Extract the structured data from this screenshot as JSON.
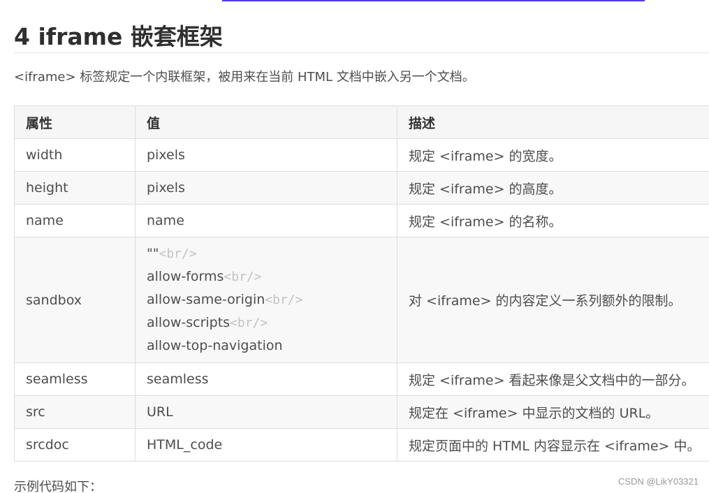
{
  "heading": "4 iframe 嵌套框架",
  "intro": "<iframe> 标签规定一个内联框架，被用来在当前 HTML 文档中嵌入另一个文档。",
  "table": {
    "headers": [
      "属性",
      "值",
      "描述"
    ],
    "rows": [
      {
        "attr": "width",
        "value": [
          "pixels"
        ],
        "desc": "规定 <iframe> 的宽度。"
      },
      {
        "attr": "height",
        "value": [
          "pixels"
        ],
        "desc": "规定 <iframe> 的高度。"
      },
      {
        "attr": "name",
        "value": [
          "name"
        ],
        "desc": "规定 <iframe> 的名称。"
      },
      {
        "attr": "sandbox",
        "value": [
          "\"\"",
          "allow-forms",
          "allow-same-origin",
          "allow-scripts",
          "allow-top-navigation"
        ],
        "desc": "对 <iframe> 的内容定义一系列额外的限制。"
      },
      {
        "attr": "seamless",
        "value": [
          "seamless"
        ],
        "desc": "规定 <iframe> 看起来像是父文档中的一部分。"
      },
      {
        "attr": "src",
        "value": [
          "URL"
        ],
        "desc": "规定在 <iframe> 中显示的文档的 URL。"
      },
      {
        "attr": "srcdoc",
        "value": [
          "HTML_code"
        ],
        "desc": "规定页面中的 HTML 内容显示在 <iframe> 中。"
      }
    ],
    "br_tag": "<br/>"
  },
  "footer_text": "示例代码如下：",
  "watermark": "CSDN @LikY03321",
  "colors": {
    "top_rule": "#4b3cf0",
    "text": "#4d4d4d",
    "border": "#dddddd",
    "br_tag": "#c2c2c2"
  }
}
